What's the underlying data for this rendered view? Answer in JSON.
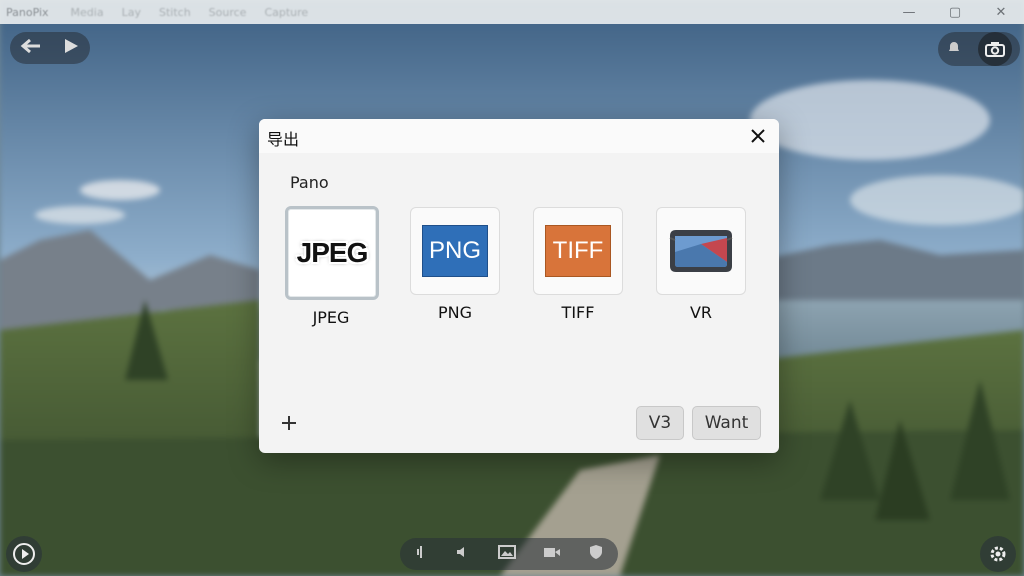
{
  "titlebar": {
    "app_title": "PanoPix",
    "menu": [
      "Media",
      "Lay",
      "Stitch",
      "Source",
      "Capture"
    ],
    "minimize_glyph": "—",
    "maximize_glyph": "▢",
    "close_glyph": "✕"
  },
  "dialog": {
    "title": "导出",
    "section": "Pano",
    "formats": [
      {
        "label": "JPEG",
        "icon_text": "JPEG",
        "icon": "jpeg-icon",
        "selected": true
      },
      {
        "label": "PNG",
        "icon_text": "PNG",
        "icon": "png-icon",
        "color": "#2f6fb8"
      },
      {
        "label": "TIFF",
        "icon_text": "TIFF",
        "icon": "tiff-icon",
        "color": "#d8743a"
      },
      {
        "label": "VR",
        "icon_text": "",
        "icon": "vr-headset-icon"
      }
    ],
    "add_glyph": "+",
    "buttons": {
      "v3": "V3",
      "want": "Want"
    }
  },
  "colors": {
    "dialog_bg": "#f3f3f3",
    "accent_selected": "#b9c2c8"
  }
}
